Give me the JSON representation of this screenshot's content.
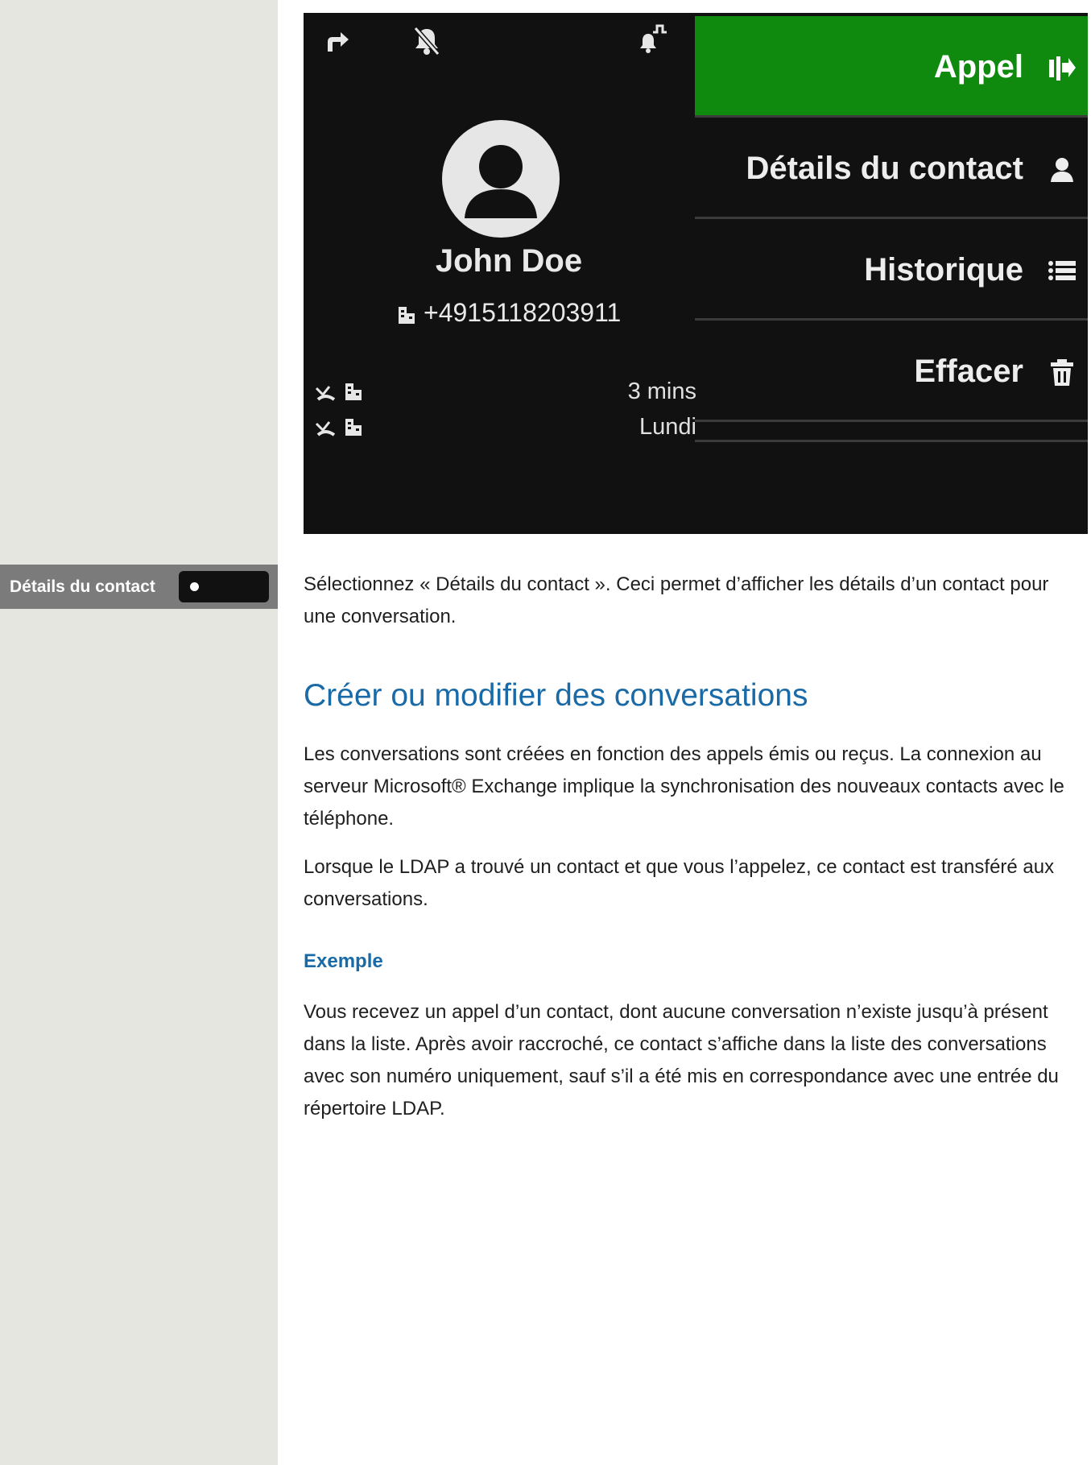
{
  "sidebar": {
    "label": "Détails du contact"
  },
  "phone_screen": {
    "status_icons": [
      "call-forward-icon",
      "bell-muted-icon",
      "bell-signal-icon"
    ],
    "contact": {
      "name": "John Doe",
      "number": "+4915118203911",
      "number_icon": "building-icon"
    },
    "history": [
      {
        "icons": [
          "call-missed-icon",
          "building-icon"
        ],
        "time": "3 mins"
      },
      {
        "icons": [
          "call-missed-icon",
          "building-icon"
        ],
        "time": "Lundi"
      }
    ],
    "menu": [
      {
        "label": "Appel",
        "icon": "call-transfer-icon",
        "active": true
      },
      {
        "label": "Détails du contact",
        "icon": "person-icon",
        "active": false
      },
      {
        "label": "Historique",
        "icon": "list-icon",
        "active": false
      },
      {
        "label": "Effacer",
        "icon": "trash-icon",
        "active": false
      }
    ],
    "colors": {
      "background": "#111111",
      "active": "#0f8a0f"
    }
  },
  "content": {
    "intro": "Sélectionnez « Détails du contact ». Ceci permet d’afficher les détails d’un contact pour une conversation.",
    "section_title": "Créer ou modifier des conversations",
    "para1": "Les conversations sont créées en fonction des appels émis ou reçus. La connexion au serveur Microsoft® Exchange implique la synchronisation des nouveaux contacts avec le téléphone.",
    "para2": "Lorsque le LDAP a trouvé un contact et que vous l’appelez, ce contact est transféré aux conversations.",
    "example_title": "Exemple",
    "para3": "Vous recevez un appel d’un contact, dont aucune conversation n’existe jusqu’à présent dans la liste. Après avoir raccroché, ce contact s’affiche dans la liste des conversations avec son numéro uniquement, sauf s’il a été mis en correspondance avec une entrée du répertoire LDAP."
  },
  "colors": {
    "heading": "#1a6aa7",
    "sidebar": "#e6e6e1",
    "sidebar_label": "#7b7b7b"
  }
}
